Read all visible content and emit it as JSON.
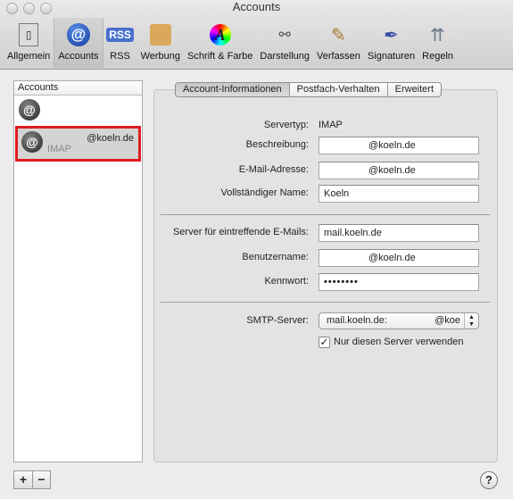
{
  "window": {
    "title": "Accounts"
  },
  "toolbar": {
    "items": [
      {
        "label": "Allgemein",
        "icon": "switch-icon"
      },
      {
        "label": "Accounts",
        "icon": "at-icon",
        "selected": true
      },
      {
        "label": "RSS",
        "icon": "rss-icon"
      },
      {
        "label": "Werbung",
        "icon": "junk-mail-icon"
      },
      {
        "label": "Schrift & Farbe",
        "icon": "font-color-icon"
      },
      {
        "label": "Darstellung",
        "icon": "glasses-icon"
      },
      {
        "label": "Verfassen",
        "icon": "compose-icon"
      },
      {
        "label": "Signaturen",
        "icon": "pen-icon"
      },
      {
        "label": "Regeln",
        "icon": "rules-icon"
      }
    ]
  },
  "sidebar": {
    "header": "Accounts",
    "accounts": [
      {
        "name": "",
        "type": ""
      },
      {
        "name": "@koeln.de",
        "type": "IMAP",
        "selected": true
      }
    ],
    "add_label": "+",
    "remove_label": "−"
  },
  "tabs": [
    {
      "label": "Account-Informationen",
      "selected": true
    },
    {
      "label": "Postfach-Verhalten"
    },
    {
      "label": "Erweitert"
    }
  ],
  "form": {
    "servertype_label": "Servertyp:",
    "servertype_value": "IMAP",
    "description_label": "Beschreibung:",
    "description_value": "@koeln.de",
    "email_label": "E-Mail-Adresse:",
    "email_value": "@koeln.de",
    "fullname_label": "Vollständiger Name:",
    "fullname_value": "Koeln",
    "incoming_label": "Server für eintreffende E-Mails:",
    "incoming_value": "mail.koeln.de",
    "username_label": "Benutzername:",
    "username_value": "@koeln.de",
    "password_label": "Kennwort:",
    "password_value": "••••••••",
    "smtp_label": "SMTP-Server:",
    "smtp_value": "mail.koeln.de:",
    "smtp_value_right": "@koe",
    "only_server_label": "Nur diesen Server verwenden",
    "only_server_checked": true
  },
  "help_label": "?"
}
